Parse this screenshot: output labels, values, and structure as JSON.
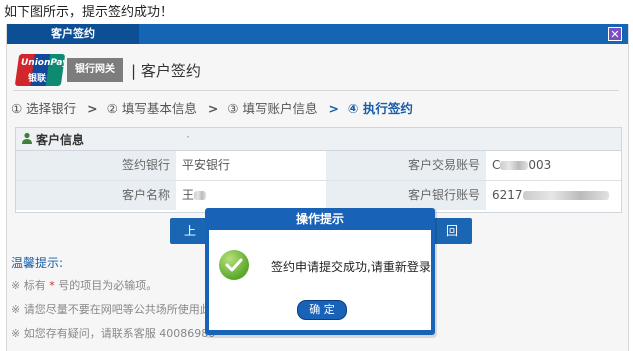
{
  "caption": "如下图所示，提示签约成功！",
  "window": {
    "tab_title": "客户签约",
    "close_glyph": "✕"
  },
  "header": {
    "logo_line1": "UnionPay",
    "logo_line2": "银联",
    "gateway_label": "银行网关",
    "page_title": "| 客户签约"
  },
  "steps": [
    {
      "label": "① 选择银行"
    },
    {
      "label": "② 填写基本信息"
    },
    {
      "label": "③ 填写账户信息"
    },
    {
      "label": "④ 执行签约"
    }
  ],
  "step_separator": ">",
  "customer_info": {
    "heading": "客户信息",
    "dot": "·",
    "rows": [
      {
        "label1": "签约银行",
        "value1": "平安银行",
        "label2": "客户交易账号",
        "value2_prefix": "C",
        "value2_suffix": "003"
      },
      {
        "label1": "客户名称",
        "value1_prefix": "王",
        "label2": "客户银行账号",
        "value2_prefix": "6217"
      }
    ]
  },
  "buttons": {
    "left_visible": "上",
    "right_visible": "回"
  },
  "tips": {
    "heading": "温馨提示:",
    "line1_a": "※ 标有",
    "line1_star": "*",
    "line1_b": "号的项目为必输项。",
    "line2": "※ 请您尽量不要在网吧等公共场所使用此系",
    "line3": "※ 如您存有疑问，请联系客服 40086980"
  },
  "dialog": {
    "title": "操作提示",
    "message": "签约申请提交成功,请重新登录",
    "confirm_label": "确 定"
  }
}
